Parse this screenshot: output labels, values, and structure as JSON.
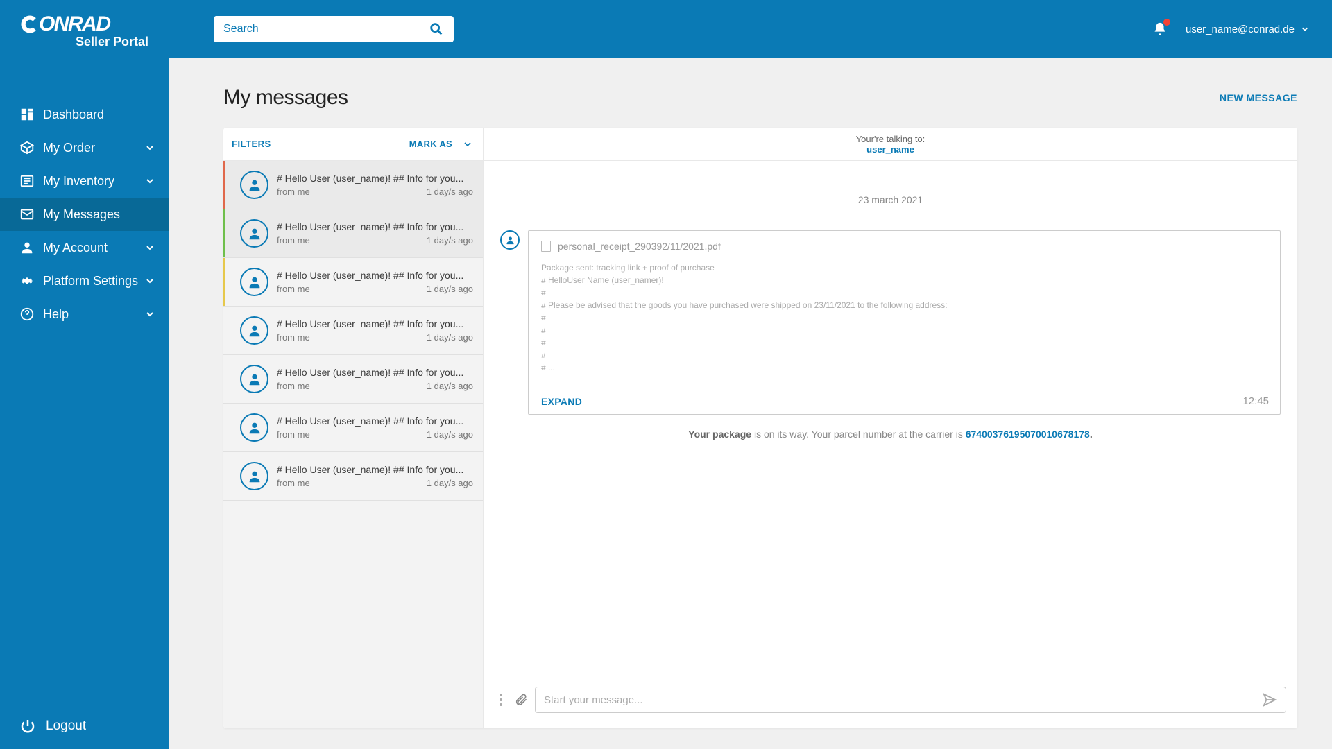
{
  "brand": {
    "name": "CONRAD",
    "sub": "Seller Portal"
  },
  "search": {
    "placeholder": "Search"
  },
  "topbar": {
    "user_email": "user_name@conrad.de"
  },
  "sidebar": {
    "items": [
      {
        "label": "Dashboard",
        "expandable": false
      },
      {
        "label": "My Order",
        "expandable": true
      },
      {
        "label": "My Inventory",
        "expandable": true
      },
      {
        "label": "My Messages",
        "expandable": false
      },
      {
        "label": "My Account",
        "expandable": true
      },
      {
        "label": "Platform Settings",
        "expandable": true
      },
      {
        "label": "Help",
        "expandable": true
      }
    ],
    "logout": "Logout"
  },
  "page": {
    "title": "My messages",
    "new_message": "NEW MESSAGE"
  },
  "list": {
    "filters": "FILTERS",
    "mark_as": "MARK AS",
    "items": [
      {
        "subject": "# Hello User (user_name)! ## Info for you...",
        "from": "from me",
        "time": "1 day/s ago",
        "bar": "#e0684b"
      },
      {
        "subject": "# Hello User (user_name)! ## Info for you...",
        "from": "from me",
        "time": "1 day/s ago",
        "bar": "#6fbf4b"
      },
      {
        "subject": "# Hello User (user_name)! ## Info for you...",
        "from": "from me",
        "time": "1 day/s ago",
        "bar": "#e6c84b"
      },
      {
        "subject": "# Hello User (user_name)! ## Info for you...",
        "from": "from me",
        "time": "1 day/s ago",
        "bar": ""
      },
      {
        "subject": "# Hello User (user_name)! ## Info for you...",
        "from": "from me",
        "time": "1 day/s ago",
        "bar": ""
      },
      {
        "subject": "# Hello User (user_name)! ## Info for you...",
        "from": "from me",
        "time": "1 day/s ago",
        "bar": ""
      },
      {
        "subject": "# Hello User (user_name)! ## Info for you...",
        "from": "from me",
        "time": "1 day/s ago",
        "bar": ""
      }
    ]
  },
  "conversation": {
    "talking_to_label": "Your're talking to:",
    "talking_to_name": "user_name",
    "date": "23 march 2021",
    "attachment": "personal_receipt_290392/11/2021.pdf",
    "body": "Package sent: tracking link + proof of purchase\n# HelloUser Name (user_namer)!\n#\n# Please be advised that the goods you have purchased were shipped on 23/11/2021 to the following address:\n#\n#\n#\n#\n# ...",
    "expand": "EXPAND",
    "time": "12:45",
    "status_prefix": "Your package",
    "status_mid": " is on its way. Your parcel number at the carrier is ",
    "status_track": "67400376195070010678178",
    "status_dot": "."
  },
  "composer": {
    "placeholder": "Start your message..."
  }
}
